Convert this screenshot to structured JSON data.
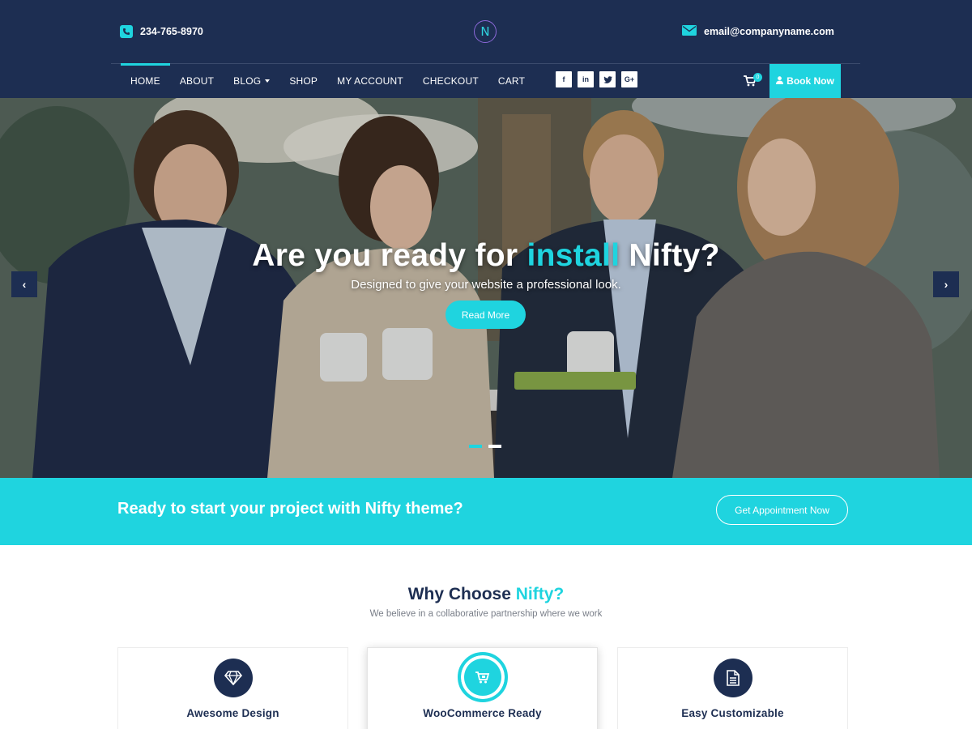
{
  "header": {
    "phone": "234-765-8970",
    "logo_letter": "N",
    "email": "email@companyname.com",
    "nav": [
      {
        "label": "HOME",
        "active": true
      },
      {
        "label": "ABOUT"
      },
      {
        "label": "BLOG",
        "dropdown": true
      },
      {
        "label": "SHOP"
      },
      {
        "label": "MY ACCOUNT"
      },
      {
        "label": "CHECKOUT"
      },
      {
        "label": "CART"
      }
    ],
    "socials": [
      {
        "icon": "facebook-icon",
        "glyph": "f"
      },
      {
        "icon": "linkedin-icon",
        "glyph": "in"
      },
      {
        "icon": "twitter-icon",
        "glyph": "t"
      },
      {
        "icon": "google-plus-icon",
        "glyph": "G+"
      }
    ],
    "cart_count": "0",
    "book_label": "Book Now"
  },
  "hero": {
    "title_before": "Are you ready for ",
    "title_highlight": "install",
    "title_after": " Nifty?",
    "subtitle": "Designed to give your website a professional look.",
    "button": "Read More",
    "prev_glyph": "‹",
    "next_glyph": "›",
    "slides": 2,
    "active_slide": 1
  },
  "cta": {
    "text": "Ready to start your project with Nifty theme?",
    "button": "Get Appointment Now"
  },
  "why": {
    "title_before": "Why Choose ",
    "title_highlight": "Nifty?",
    "subtitle": "We believe in a collaborative partnership where we work",
    "cards": [
      {
        "title": "Awesome Design",
        "icon": "diamond-icon"
      },
      {
        "title": "WooCommerce Ready",
        "icon": "cart-icon"
      },
      {
        "title": "Easy Customizable",
        "icon": "document-icon"
      }
    ]
  },
  "colors": {
    "navy": "#1d2e52",
    "accent": "#1fd4df",
    "white": "#ffffff"
  }
}
